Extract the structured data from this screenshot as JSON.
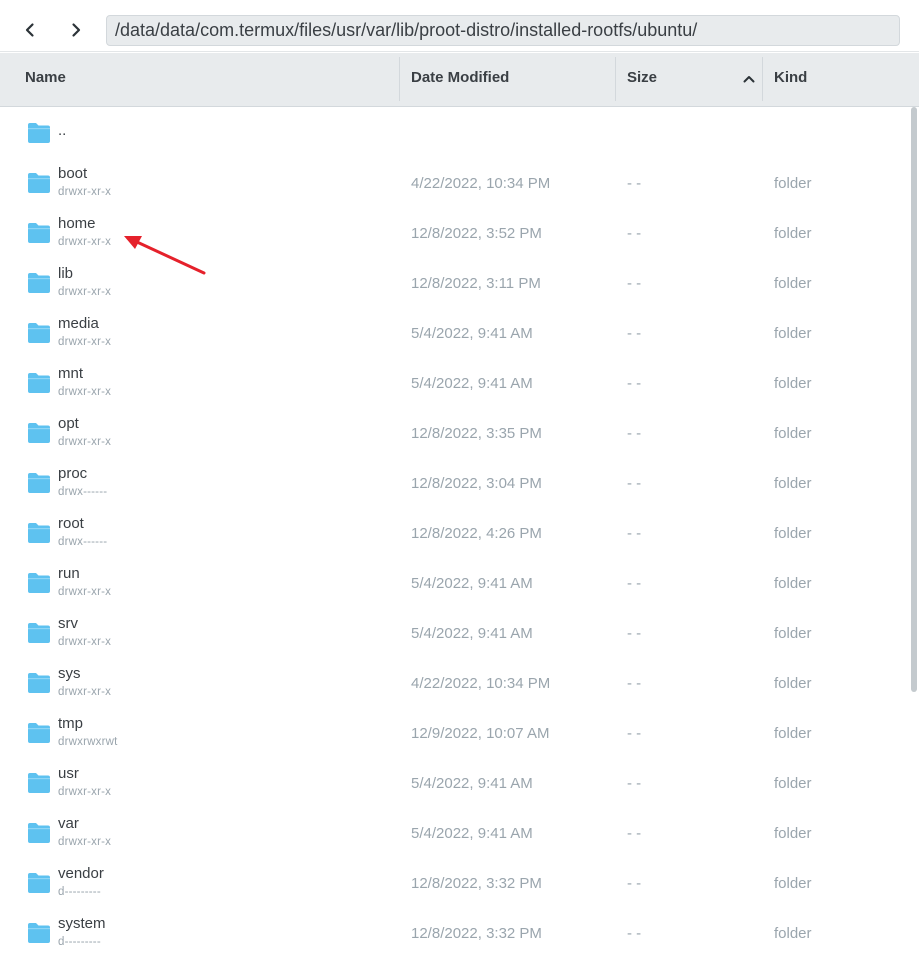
{
  "toolbar": {
    "back_icon": "chevron-left-icon",
    "forward_icon": "chevron-right-icon",
    "path": "/data/data/com.termux/files/usr/var/lib/proot-distro/installed-rootfs/ubuntu/"
  },
  "columns": {
    "name": "Name",
    "date": "Date Modified",
    "size": "Size",
    "kind": "Kind",
    "sort_icon": "chevron-up-icon"
  },
  "colors": {
    "folder": "#5ec2f0",
    "header_bg": "#e8ebed",
    "annotation_arrow": "#e5212b"
  },
  "parent": {
    "name": ".."
  },
  "rows": [
    {
      "name": "boot",
      "perm": "drwxr-xr-x",
      "date": "4/22/2022, 10:34 PM",
      "size": "- -",
      "kind": "folder"
    },
    {
      "name": "home",
      "perm": "drwxr-xr-x",
      "date": "12/8/2022, 3:52 PM",
      "size": "- -",
      "kind": "folder"
    },
    {
      "name": "lib",
      "perm": "drwxr-xr-x",
      "date": "12/8/2022, 3:11 PM",
      "size": "- -",
      "kind": "folder"
    },
    {
      "name": "media",
      "perm": "drwxr-xr-x",
      "date": "5/4/2022, 9:41 AM",
      "size": "- -",
      "kind": "folder"
    },
    {
      "name": "mnt",
      "perm": "drwxr-xr-x",
      "date": "5/4/2022, 9:41 AM",
      "size": "- -",
      "kind": "folder"
    },
    {
      "name": "opt",
      "perm": "drwxr-xr-x",
      "date": "12/8/2022, 3:35 PM",
      "size": "- -",
      "kind": "folder"
    },
    {
      "name": "proc",
      "perm": "drwx------",
      "date": "12/8/2022, 3:04 PM",
      "size": "- -",
      "kind": "folder"
    },
    {
      "name": "root",
      "perm": "drwx------",
      "date": "12/8/2022, 4:26 PM",
      "size": "- -",
      "kind": "folder"
    },
    {
      "name": "run",
      "perm": "drwxr-xr-x",
      "date": "5/4/2022, 9:41 AM",
      "size": "- -",
      "kind": "folder"
    },
    {
      "name": "srv",
      "perm": "drwxr-xr-x",
      "date": "5/4/2022, 9:41 AM",
      "size": "- -",
      "kind": "folder"
    },
    {
      "name": "sys",
      "perm": "drwxr-xr-x",
      "date": "4/22/2022, 10:34 PM",
      "size": "- -",
      "kind": "folder"
    },
    {
      "name": "tmp",
      "perm": "drwxrwxrwt",
      "date": "12/9/2022, 10:07 AM",
      "size": "- -",
      "kind": "folder"
    },
    {
      "name": "usr",
      "perm": "drwxr-xr-x",
      "date": "5/4/2022, 9:41 AM",
      "size": "- -",
      "kind": "folder"
    },
    {
      "name": "var",
      "perm": "drwxr-xr-x",
      "date": "5/4/2022, 9:41 AM",
      "size": "- -",
      "kind": "folder"
    },
    {
      "name": "vendor",
      "perm": "d---------",
      "date": "12/8/2022, 3:32 PM",
      "size": "- -",
      "kind": "folder"
    },
    {
      "name": "system",
      "perm": "d---------",
      "date": "12/8/2022, 3:32 PM",
      "size": "- -",
      "kind": "folder"
    }
  ]
}
